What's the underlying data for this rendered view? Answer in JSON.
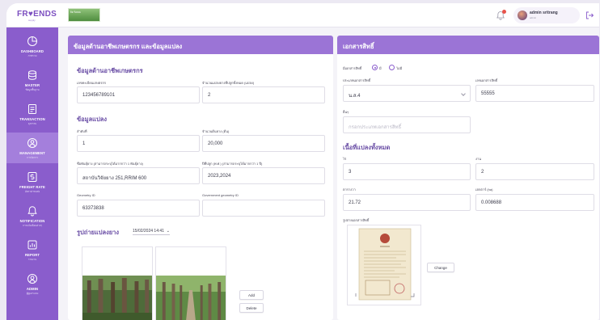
{
  "header": {
    "logo_text": "FR♥ENDS",
    "logo_sub": "supply",
    "thumb_text": "ยิด ร้อยยะ",
    "user_name": "admin sritrang",
    "user_role": "admin"
  },
  "sidebar": {
    "items": [
      {
        "label": "DASHBOARD",
        "sub": "ภาพรวม",
        "icon": "dashboard-icon"
      },
      {
        "label": "MASTER",
        "sub": "ข้อมูลพื้นฐาน",
        "icon": "master-icon"
      },
      {
        "label": "TRANSACTION",
        "sub": "ธุรกรรม",
        "icon": "transaction-icon"
      },
      {
        "label": "MANAGEMENT",
        "sub": "การจัดการ",
        "icon": "management-icon"
      },
      {
        "label": "FREIGHT RATE",
        "sub": "อัตราค่าขนส่ง",
        "icon": "freight-icon"
      },
      {
        "label": "NOTIFICATION",
        "sub": "การแจ้งเตือนต่างๆ",
        "icon": "notification-icon"
      },
      {
        "label": "REPORT",
        "sub": "รายงาน",
        "icon": "report-icon"
      },
      {
        "label": "ADMIN",
        "sub": "ผู้ดูแลระบบ",
        "icon": "admin-icon"
      }
    ]
  },
  "left_panel": {
    "title": "ข้อมูลด้านอาชีพเกษตรกร และข้อมูลแปลง",
    "farmer_section": "ข้อมูลด้านอาชีพเกษตรกร",
    "farmer_reg_label": "เลขทะเบียนเกษตรกร",
    "farmer_reg_value": "123456789101",
    "plot_count_label": "จำนวนแปลงยางที่ปลูกทั้งหมด (แปลง)",
    "plot_count_value": "2",
    "plot_section": "ข้อมูลแปลง",
    "order_label": "ลำดับที่",
    "order_value": "1",
    "tree_count_label": "จำนวนต้นยาง (ต้น)",
    "tree_count_value": "20,000",
    "variety_label": "ชื่อพันธุ์ยาง (สามารถระบุได้มากกว่า 1 พันธุ์ยาง)",
    "variety_value": "สถาบันวิจัยยาง 251,RRIM 600",
    "year_label": "ปีที่ปลูก (พ.ศ.) (สามารถระบุได้มากกว่า 1 ปี)",
    "year_value": "2023,2024",
    "geo_label": "Geometry ID",
    "geo_value": "63373838",
    "gov_geo_label": "Government geometry ID",
    "gov_geo_value": "",
    "photo_title": "รูปถ่ายแปลงยาง",
    "photo_date": "15/02/2024  14:41",
    "add_button": "Add",
    "delete_button": "Delete"
  },
  "right_panel": {
    "title": "เอกสารสิทธิ์",
    "has_doc_label": "มีเอกสารสิทธิ์",
    "yes_label": "มี",
    "no_label": "ไม่มี",
    "doc_type_label": "ประเภทเอกสารสิทธิ์",
    "doc_type_value": "น.ส.4",
    "doc_no_label": "เลขเอกสารสิทธิ์",
    "doc_no_value": "55555",
    "other_label": "อื่นๆ",
    "other_placeholder": "กรอกประเภทเอกสารสิทธิ์",
    "area_section": "เนื้อที่แปลงทั้งหมด",
    "rai_label": "ไร่",
    "rai_value": "3",
    "ngan_label": "งาน",
    "ngan_value": "2",
    "wa_label": "ตารางวา",
    "wa_value": "21.72",
    "ha_label": "เฮกตาร์ (ha)",
    "ha_value": "0.008688",
    "doc_image_label": "รูปถ่ายเอกสารสิทธิ์",
    "change_button": "Change"
  },
  "colors": {
    "sidebar": "#8a5dcc",
    "panel_header": "#9b74d6",
    "accent": "#6b4fa6"
  }
}
